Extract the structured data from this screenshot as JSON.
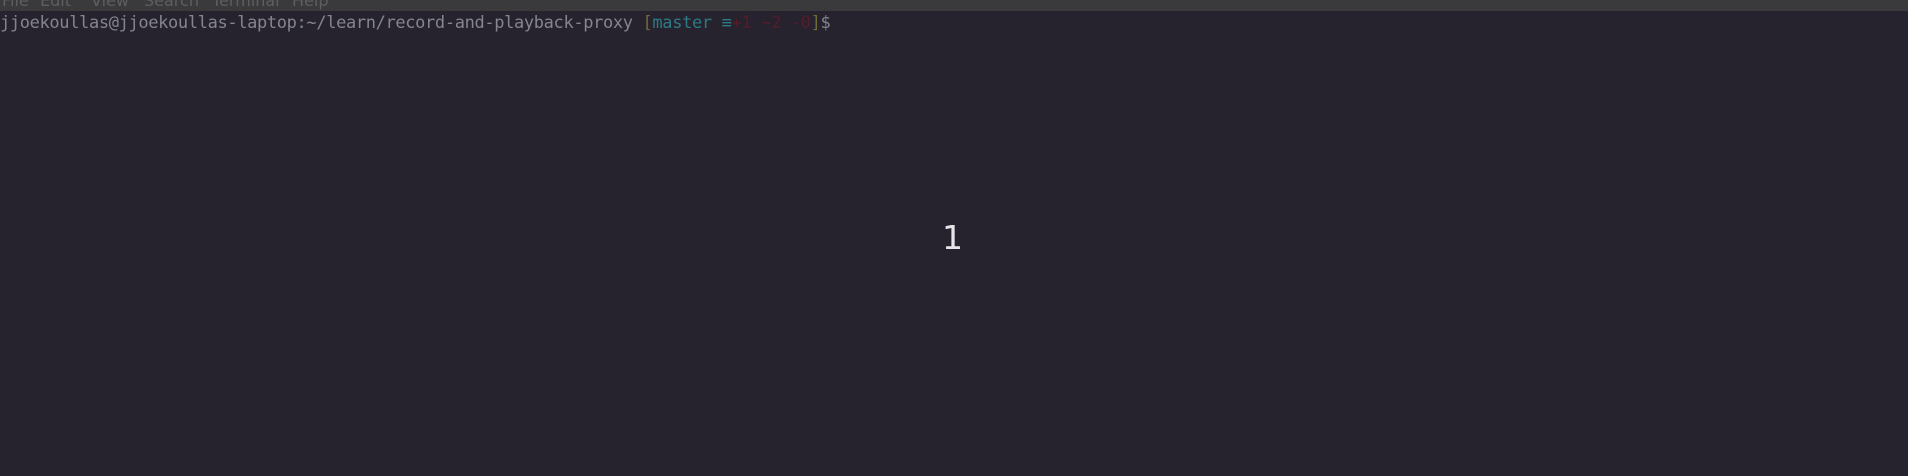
{
  "menu": {
    "items": [
      {
        "label": "File"
      },
      {
        "label": "Edit"
      },
      {
        "label": "View"
      },
      {
        "label": "Search"
      },
      {
        "label": "Terminal"
      },
      {
        "label": "Help"
      }
    ]
  },
  "prompt": {
    "user_host_path": "jjoekoullas@jjoekoullas-laptop:~/learn/record-and-playback-proxy",
    "space": " ",
    "open_bracket": "[",
    "branch": "master",
    "sync_symbol": " ≡",
    "status_added": "+1",
    "status_modified": " ~2",
    "status_deleted": " -0",
    "close_bracket": "]",
    "dollar": "$"
  },
  "overlay": {
    "center_number": "1"
  },
  "colors": {
    "background": "#26232e",
    "menubar": "#3a3a3d",
    "user_text": "#85858d",
    "bracket": "#6f6a38",
    "branch": "#2d7a84",
    "status": "#561b2b",
    "overlay_number": "#e6e6ea"
  }
}
